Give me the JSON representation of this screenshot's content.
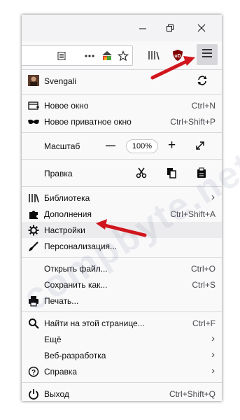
{
  "colors": {
    "annotation_red": "#d0161c",
    "menu_bg": "#f9f9fa",
    "highlight": "#ececee",
    "ublock_red": "#800000"
  },
  "toolbar": {
    "icons": [
      "reader-view-icon",
      "page-actions-icon",
      "pocket-icon",
      "bookmark-star-icon",
      "library-icon",
      "ublock-icon",
      "hamburger-menu-icon"
    ],
    "ublock_label": "uD"
  },
  "menu": {
    "account": {
      "name": "Svengali"
    },
    "new_window": {
      "label": "Новое окно",
      "shortcut": "Ctrl+N"
    },
    "private_window": {
      "label": "Новое приватное окно",
      "shortcut": "Ctrl+Shift+P"
    },
    "zoom": {
      "label": "Масштаб",
      "minus": "—",
      "value": "100%",
      "plus": "+"
    },
    "edit": {
      "label": "Правка"
    },
    "library": {
      "label": "Библиотека",
      "arrow": "›"
    },
    "addons": {
      "label": "Дополнения",
      "shortcut": "Ctrl+Shift+A"
    },
    "settings": {
      "label": "Настройки"
    },
    "customize": {
      "label": "Персонализация..."
    },
    "open_file": {
      "label": "Открыть файл...",
      "shortcut": "Ctrl+O"
    },
    "save_as": {
      "label": "Сохранить как...",
      "shortcut": "Ctrl+S"
    },
    "print": {
      "label": "Печать..."
    },
    "find": {
      "label": "Найти на этой странице...",
      "shortcut": "Ctrl+F"
    },
    "more": {
      "label": "Ещё",
      "arrow": "›"
    },
    "webdev": {
      "label": "Веб-разработка",
      "arrow": "›"
    },
    "help": {
      "label": "Справка",
      "arrow": "›"
    },
    "quit": {
      "label": "Выход",
      "shortcut": "Ctrl+Shift+Q"
    }
  },
  "watermark": "compbyte.net"
}
